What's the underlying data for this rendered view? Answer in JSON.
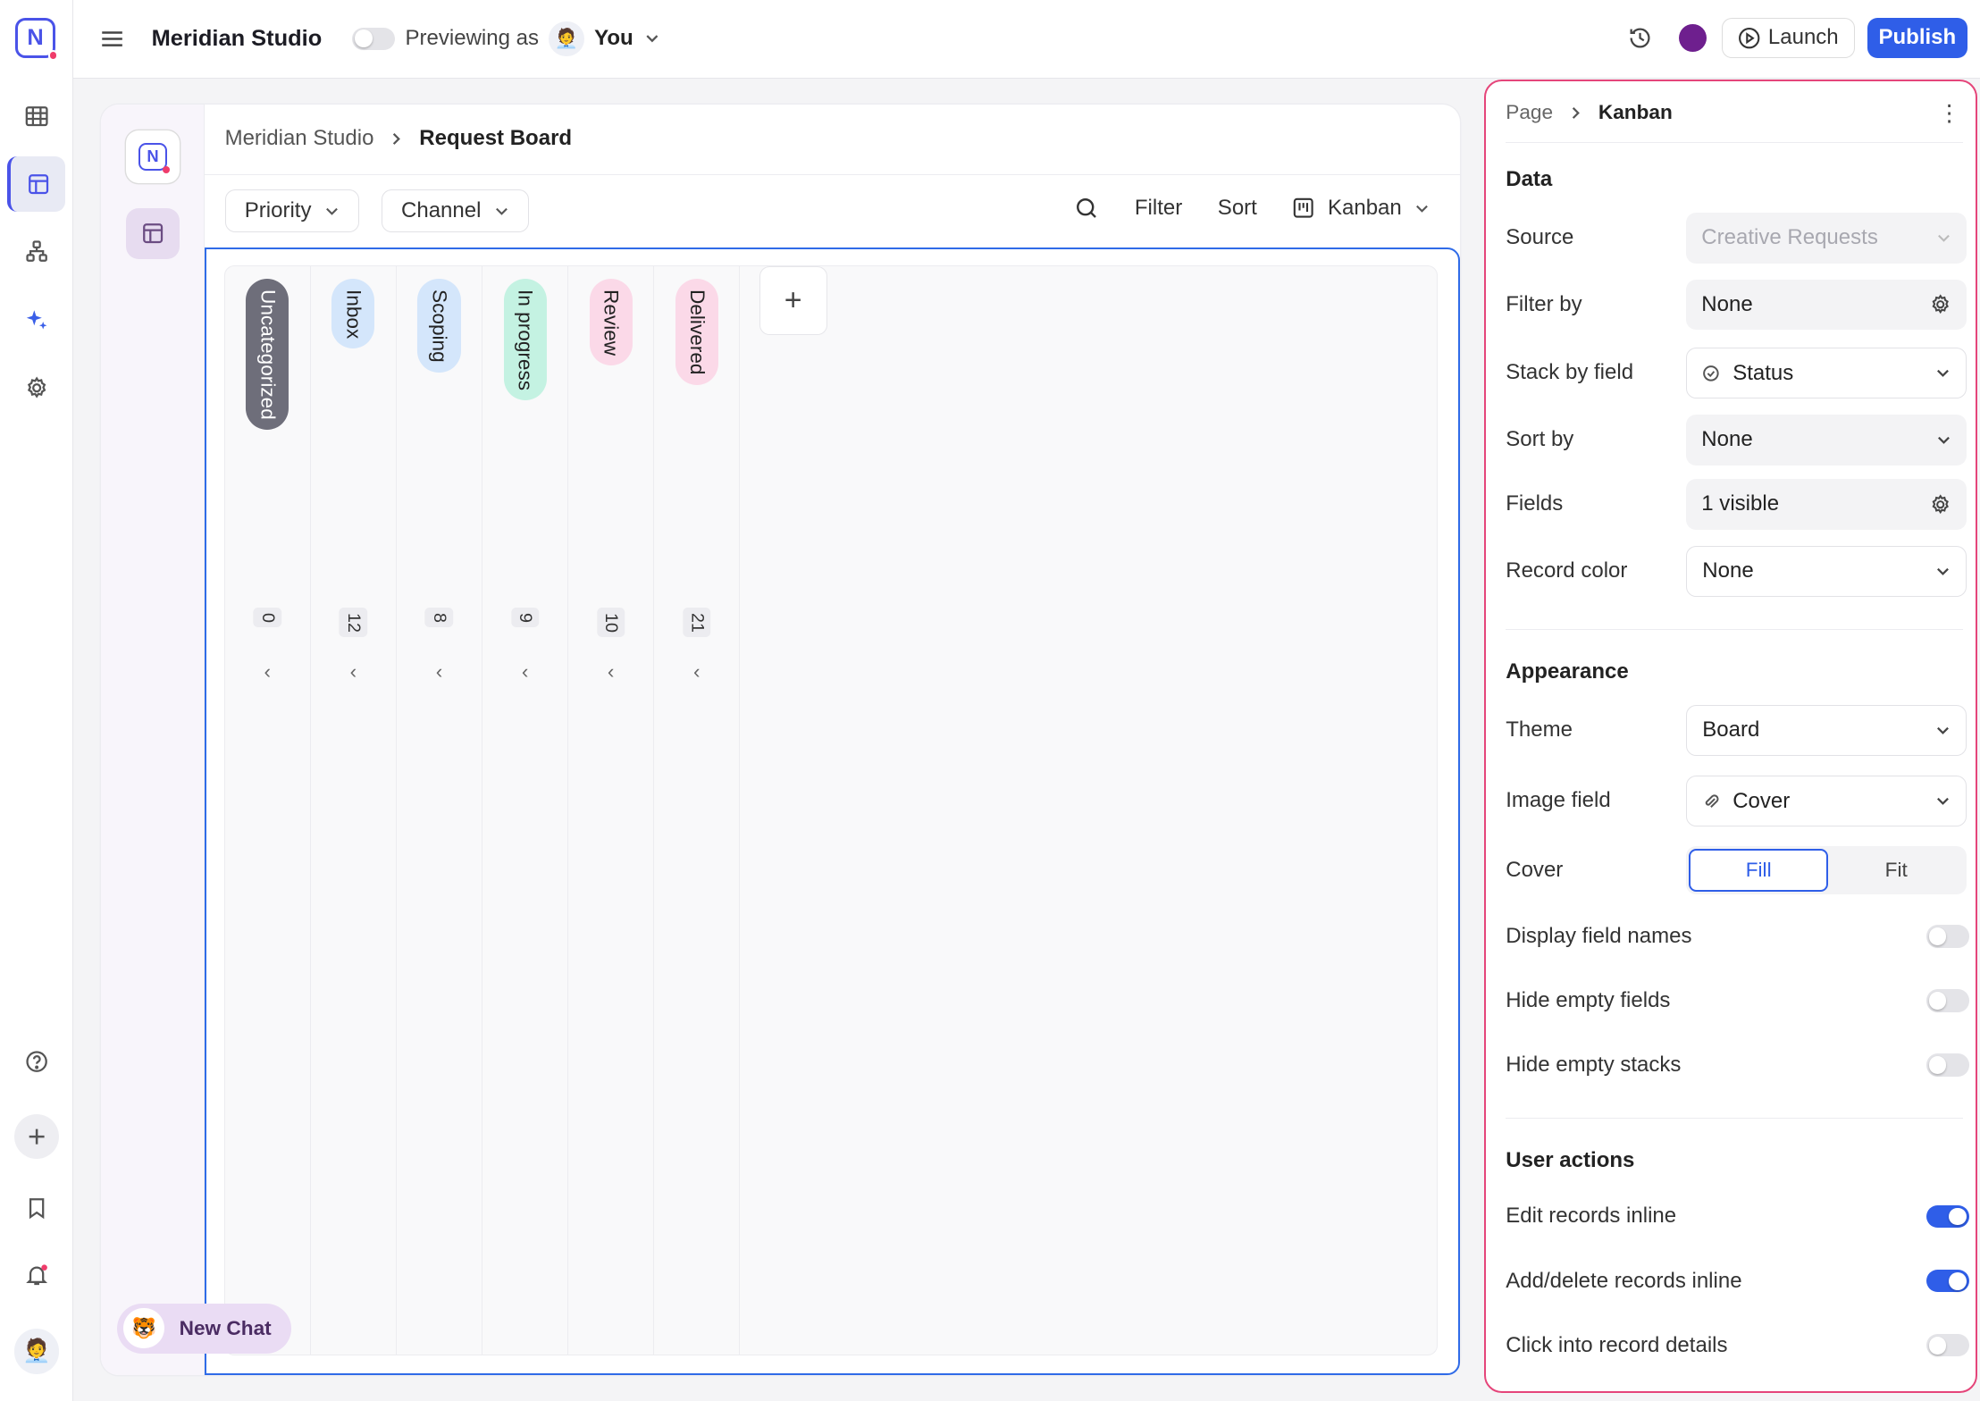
{
  "app": {
    "title": "Meridian Studio",
    "previewing_label": "Previewing as",
    "preview_user": "You",
    "preview_avatar": "🧑‍💼"
  },
  "toolbar": {
    "launch_label": "Launch",
    "publish_label": "Publish",
    "accent": "#2f5ee8",
    "profile_color": "#6e1f8e"
  },
  "breadcrumb": {
    "root": "Meridian Studio",
    "current": "Request Board"
  },
  "filters": {
    "priority_label": "Priority",
    "channel_label": "Channel",
    "filter_label": "Filter",
    "sort_label": "Sort",
    "view_label": "Kanban"
  },
  "kanban": {
    "columns": [
      {
        "label": "Uncategorized",
        "count": "0",
        "color": "#6e6e7a",
        "text_color": "#ffffff"
      },
      {
        "label": "Inbox",
        "count": "12",
        "color": "#d4e6fb",
        "text_color": "#222222"
      },
      {
        "label": "Scoping",
        "count": "8",
        "color": "#d4e6fb",
        "text_color": "#222222"
      },
      {
        "label": "In progress",
        "count": "9",
        "color": "#c4f2e2",
        "text_color": "#222222"
      },
      {
        "label": "Review",
        "count": "10",
        "color": "#fbd9e8",
        "text_color": "#222222"
      },
      {
        "label": "Delivered",
        "count": "21",
        "color": "#fbd9e8",
        "text_color": "#222222"
      }
    ]
  },
  "chat": {
    "label": "New Chat",
    "icon": "🐯"
  },
  "panel": {
    "crumb_root": "Page",
    "crumb_current": "Kanban",
    "data_title": "Data",
    "source_label": "Source",
    "source_value": "Creative Requests",
    "filter_by_label": "Filter by",
    "filter_by_value": "None",
    "stack_label": "Stack by field",
    "stack_value": "Status",
    "sort_by_label": "Sort by",
    "sort_by_value": "None",
    "fields_label": "Fields",
    "fields_value": "1 visible",
    "record_color_label": "Record color",
    "record_color_value": "None",
    "appearance_title": "Appearance",
    "theme_label": "Theme",
    "theme_value": "Board",
    "image_field_label": "Image field",
    "image_field_value": "Cover",
    "cover_label": "Cover",
    "cover_fill": "Fill",
    "cover_fit": "Fit",
    "display_names_label": "Display field names",
    "hide_empty_fields_label": "Hide empty fields",
    "hide_empty_stacks_label": "Hide empty stacks",
    "actions_title": "User actions",
    "edit_inline_label": "Edit records inline",
    "add_delete_label": "Add/delete records inline",
    "click_details_label": "Click into record details"
  }
}
